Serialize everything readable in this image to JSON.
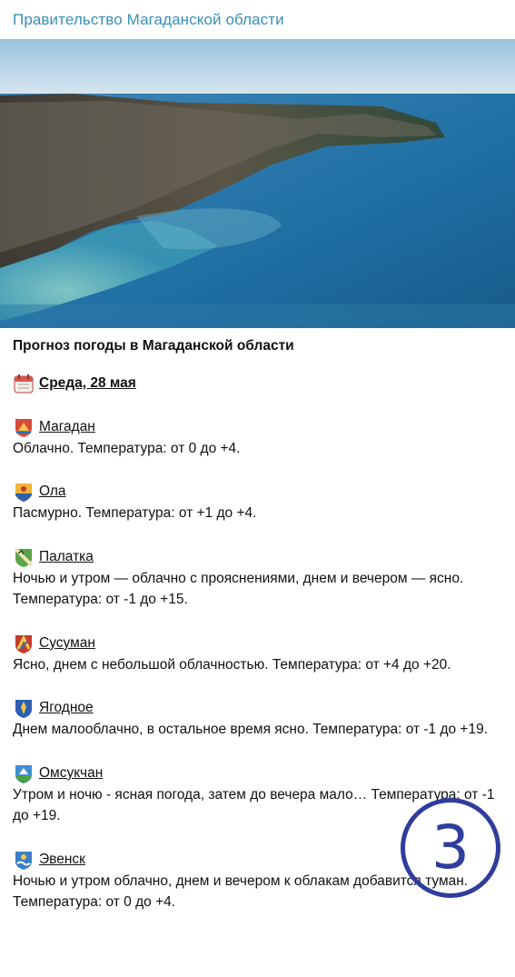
{
  "channel": {
    "name": "Правительство Магаданской области"
  },
  "post": {
    "headline": "Прогноз погоды в Магаданской области",
    "date": "Среда, 28 мая",
    "entries": [
      {
        "city": "Магадан",
        "emblem": "magadan-emblem",
        "text": "Облачно. Температура: от 0 до +4."
      },
      {
        "city": "Ола",
        "emblem": "ola-emblem",
        "text": "Пасмурно. Температура: от +1 до +4."
      },
      {
        "city": "Палатка",
        "emblem": "palatka-emblem",
        "text": "Ночью и утром — облачно с прояснениями, днем и вечером — ясно. Температура: от -1 до +15."
      },
      {
        "city": "Сусуман",
        "emblem": "susuman-emblem",
        "text": "Ясно, днем с небольшой облачностью. Температура: от +4 до +20."
      },
      {
        "city": "Ягодное",
        "emblem": "yagodnoe-emblem",
        "text": "Днем малооблачно, в остальное время ясно. Температура: от -1 до +19."
      },
      {
        "city": "Омсукчан",
        "emblem": "omsukchan-emblem",
        "text": "Утром и ночю - ясная погода, затем до вечера мало… Температура: от -1 до +19."
      },
      {
        "city": "Эвенск",
        "emblem": "evensk-emblem",
        "text": "Ночью и утром облачно, днем и вечером к облакам добавится туман. Температура: от 0 до +4."
      }
    ]
  },
  "badge": {
    "number": "3",
    "color": "#2f3d9c"
  },
  "colors": {
    "channel_name": "#3a8fb7",
    "sea": "#1f6fa3",
    "lagoon": "#6cc3c0"
  }
}
